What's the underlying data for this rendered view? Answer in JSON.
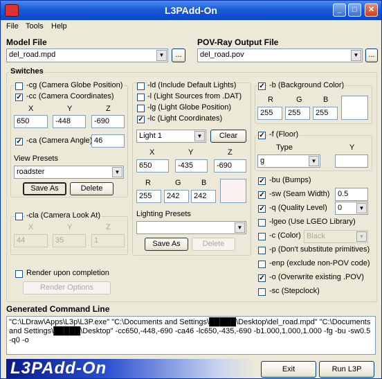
{
  "window": {
    "title": "L3PAdd-On"
  },
  "menu": [
    "File",
    "Tools",
    "Help"
  ],
  "model_file": {
    "label": "Model File",
    "value": "del_road.mpd",
    "browse": "..."
  },
  "pov_file": {
    "label": "POV-Ray Output File",
    "value": "del_road.pov",
    "browse": "..."
  },
  "switches": {
    "label": "Switches",
    "cg": {
      "label": "-cg (Camera Globe Position)",
      "checked": false
    },
    "cc": {
      "label": "-cc (Camera Coordinates)",
      "checked": true,
      "x_label": "X",
      "y_label": "Y",
      "z_label": "Z",
      "x": "650",
      "y": "-448",
      "z": "-690"
    },
    "ca": {
      "label": "-ca (Camera Angle)",
      "checked": true,
      "value": "46"
    },
    "view_presets": {
      "label": "View Presets",
      "value": "roadster",
      "save_as": "Save As",
      "delete": "Delete"
    },
    "cla": {
      "label": "-cla (Camera Look At)",
      "checked": false,
      "x_label": "X",
      "y_label": "Y",
      "z_label": "Z",
      "x": "44",
      "y": "35",
      "z": "1"
    },
    "render": {
      "label": "Render upon completion",
      "checked": false,
      "options": "Render Options"
    },
    "ld": {
      "label": "-ld (Include Default Lights)",
      "checked": false
    },
    "l": {
      "label": "-l (Light Sources from .DAT)",
      "checked": false
    },
    "lg": {
      "label": "-lg (Light Globe Position)",
      "checked": false
    },
    "lc": {
      "label": "-lc (Light Coordinates)",
      "checked": true
    },
    "light": {
      "value": "Light 1",
      "clear": "Clear",
      "x_label": "X",
      "y_label": "Y",
      "z_label": "Z",
      "x": "650",
      "y": "-435",
      "z": "-690",
      "r_label": "R",
      "g_label": "G",
      "b_label": "B",
      "r": "255",
      "g": "242",
      "b": "242",
      "swatch": "#fdf0f0"
    },
    "lighting_presets": {
      "label": "Lighting Presets",
      "value": "",
      "save_as": "Save As",
      "delete": "Delete"
    },
    "bg": {
      "label": "-b (Background Color)",
      "checked": true,
      "r_label": "R",
      "g_label": "G",
      "b_label": "B",
      "r": "255",
      "g": "255",
      "b": "255",
      "swatch": "#ffffff"
    },
    "floor": {
      "label": "-f (Floor)",
      "checked": true,
      "type_label": "Type",
      "y_label": "Y",
      "type": "g",
      "y": ""
    },
    "bu": {
      "label": "-bu (Bumps)",
      "checked": true
    },
    "sw": {
      "label": "-sw (Seam Width)",
      "checked": true,
      "value": "0.5"
    },
    "q": {
      "label": "-q (Quality Level)",
      "checked": true,
      "value": "0"
    },
    "lgeo": {
      "label": "-lgeo (Use LGEO Library)",
      "checked": false
    },
    "c": {
      "label": "-c (Color)",
      "checked": false,
      "value": "Black"
    },
    "p": {
      "label": "-p (Don't substitute primitives)",
      "checked": false
    },
    "enp": {
      "label": "-enp (exclude non-POV code)",
      "checked": false
    },
    "o": {
      "label": "-o (Overwrite existing .POV)",
      "checked": true
    },
    "sc": {
      "label": "-sc (Stepclock)",
      "checked": false
    }
  },
  "command": {
    "label": "Generated Command Line",
    "text": "\"C:\\LDraw\\Apps\\L3p\\L3P.exe\" \"C:\\Documents and Settings\\█████\\Desktop\\del_road.mpd\" \"C:\\Documents and Settings\\█████\\Desktop\" -cc650,-448,-690 -ca46 -lc650,-435,-690 -b1.000,1.000,1.000 -fg -bu -sw0.5 -q0 -o"
  },
  "footer": {
    "banner": "L3PAdd-On",
    "exit": "Exit",
    "run": "Run L3P"
  },
  "colors": {
    "titlebar": "#0a46c9",
    "window_bg": "#ece9d8",
    "field_border": "#7f9db9"
  }
}
